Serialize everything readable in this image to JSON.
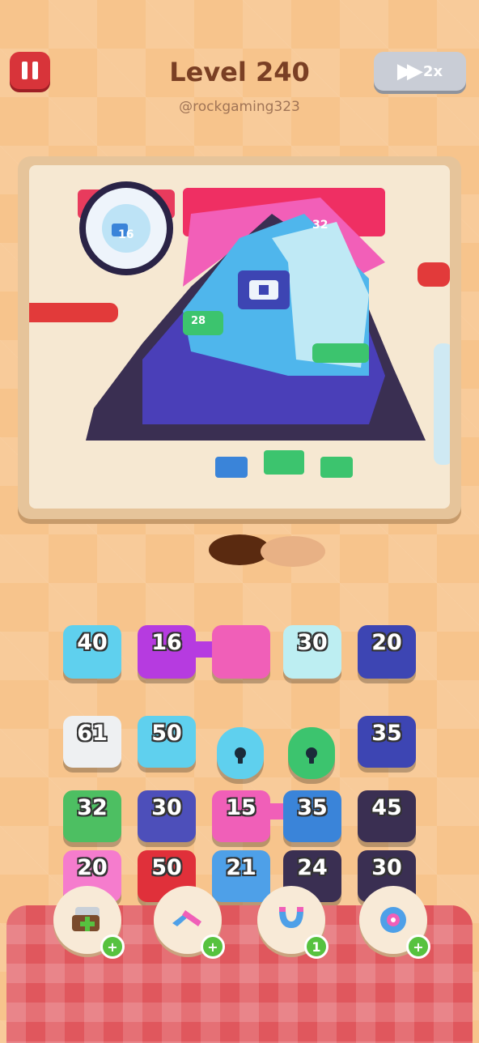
{
  "header": {
    "level_title": "Level 240",
    "username": "@rockgaming323",
    "speed_label": "2x"
  },
  "board": {
    "labels": [
      "16",
      "32",
      "28"
    ]
  },
  "tiles_top": [
    {
      "value": "40",
      "color": "#5fd0ee"
    },
    {
      "value": "16",
      "color": "#b63be0"
    },
    {
      "value": "",
      "color": "#f05fb8"
    },
    {
      "value": "30",
      "color": "#bdeef2"
    },
    {
      "value": "20",
      "color": "#3d45b3"
    }
  ],
  "tiles_grid": [
    [
      {
        "value": "61",
        "color": "#eef0f2"
      },
      {
        "value": "50",
        "color": "#5fd0ee"
      },
      {
        "lock": true,
        "color": "#5fd0ee"
      },
      {
        "lock": true,
        "color": "#3cc46e"
      },
      {
        "value": "35",
        "color": "#3d45b3"
      }
    ],
    [
      {
        "value": "32",
        "color": "#4dbf62"
      },
      {
        "value": "30",
        "color": "#4d4fba"
      },
      {
        "value": "15",
        "color": "#f05fb8"
      },
      {
        "value": "35",
        "color": "#3a84d9"
      },
      {
        "value": "45",
        "color": "#3a2f52"
      }
    ],
    [
      {
        "value": "20",
        "color": "#f57ccd"
      },
      {
        "value": "50",
        "color": "#e0303a"
      },
      {
        "value": "21",
        "color": "#4ea0e8"
      },
      {
        "value": "24",
        "color": "#3a2f52"
      },
      {
        "value": "30",
        "color": "#3a2f52"
      }
    ]
  ],
  "boosters": [
    {
      "icon": "add-slot-icon",
      "badge": "+"
    },
    {
      "icon": "swap-icon",
      "badge": "+"
    },
    {
      "icon": "magnet-icon",
      "badge": "1"
    },
    {
      "icon": "shuffle-icon",
      "badge": "+"
    }
  ]
}
